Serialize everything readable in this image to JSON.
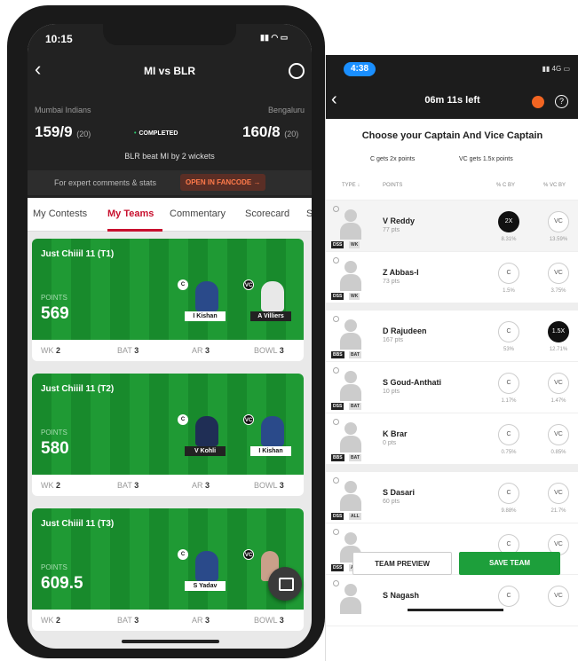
{
  "left": {
    "status": {
      "time": "10:15"
    },
    "header": {
      "title": "MI vs BLR"
    },
    "match": {
      "team1": "Mumbai Indians",
      "team2": "Bengaluru",
      "score1": "159/9",
      "overs1": "(20)",
      "score2": "160/8",
      "overs2": "(20)",
      "status": "COMPLETED",
      "result": "BLR beat MI by 2 wickets"
    },
    "fancode": {
      "text": "For expert comments & stats",
      "button": "OPEN IN FANCODE →"
    },
    "tabs": [
      "My Contests",
      "My Teams",
      "Commentary",
      "Scorecard",
      "S"
    ],
    "cards": [
      {
        "name": "Just Chiiil 11 (T1)",
        "points_label": "POINTS",
        "points": "569",
        "captain": "I Kishan",
        "vice": "A Villiers",
        "wk": "2",
        "bat": "3",
        "ar": "3",
        "bowl": "3"
      },
      {
        "name": "Just Chiiil 11 (T2)",
        "points_label": "POINTS",
        "points": "580",
        "captain": "V Kohli",
        "vice": "I Kishan",
        "wk": "2",
        "bat": "3",
        "ar": "3",
        "bowl": "3"
      },
      {
        "name": "Just Chiiil 11 (T3)",
        "points_label": "POINTS",
        "points": "609.5",
        "captain": "S Yadav",
        "vice": "",
        "wk": "2",
        "bat": "3",
        "ar": "3",
        "bowl": "3"
      }
    ],
    "labels": {
      "wk": "WK",
      "bat": "BAT",
      "ar": "AR",
      "bowl": "BOWL",
      "c": "C",
      "vc": "VC"
    }
  },
  "right": {
    "status": {
      "time": "4:38",
      "signal": "4G"
    },
    "header": {
      "title": "06m 11s left"
    },
    "title": "Choose your Captain And Vice Captain",
    "c_info": "C gets 2x points",
    "vc_info": "VC gets 1.5x points",
    "cols": {
      "type": "TYPE ↓",
      "points": "POINTS",
      "c_by": "% C BY",
      "vc_by": "% VC BY"
    },
    "players": [
      {
        "name": "V Reddy",
        "pts": "77 pts",
        "team": "DSS",
        "role": "WK",
        "c": "2X",
        "vc": "VC",
        "c_on": true,
        "vc_on": false,
        "c_pct": "8.31%",
        "vc_pct": "13.59%"
      },
      {
        "name": "Z Abbas-I",
        "pts": "73 pts",
        "team": "DSS",
        "role": "WK",
        "c": "C",
        "vc": "VC",
        "c_on": false,
        "vc_on": false,
        "c_pct": "1.5%",
        "vc_pct": "3.75%"
      },
      {
        "name": "D Rajudeen",
        "pts": "167 pts",
        "team": "BBS",
        "role": "BAT",
        "c": "C",
        "vc": "1.5X",
        "c_on": false,
        "vc_on": true,
        "c_pct": "53%",
        "vc_pct": "12.71%"
      },
      {
        "name": "S Goud-Anthati",
        "pts": "10 pts",
        "team": "DSS",
        "role": "BAT",
        "c": "C",
        "vc": "VC",
        "c_on": false,
        "vc_on": false,
        "c_pct": "1.17%",
        "vc_pct": "1.47%"
      },
      {
        "name": "K Brar",
        "pts": "0 pts",
        "team": "BBS",
        "role": "BAT",
        "c": "C",
        "vc": "VC",
        "c_on": false,
        "vc_on": false,
        "c_pct": "0.75%",
        "vc_pct": "0.85%"
      },
      {
        "name": "S Dasari",
        "pts": "60 pts",
        "team": "DSS",
        "role": "ALL",
        "c": "C",
        "vc": "VC",
        "c_on": false,
        "vc_on": false,
        "c_pct": "9.88%",
        "vc_pct": "21.7%"
      },
      {
        "name": "",
        "pts": "",
        "team": "DSS",
        "role": "ALL",
        "c": "C",
        "vc": "VC",
        "c_on": false,
        "vc_on": false,
        "c_pct": "",
        "vc_pct": ""
      },
      {
        "name": "S Nagash",
        "pts": "",
        "team": "",
        "role": "",
        "c": "C",
        "vc": "VC",
        "c_on": false,
        "vc_on": false,
        "c_pct": "",
        "vc_pct": ""
      }
    ],
    "buttons": {
      "preview": "TEAM PREVIEW",
      "save": "SAVE TEAM"
    }
  }
}
